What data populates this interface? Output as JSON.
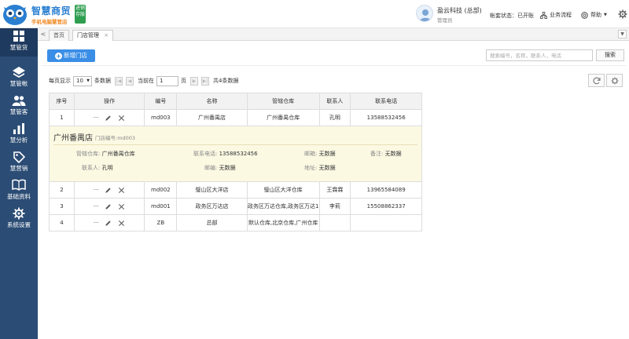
{
  "brand": {
    "title": "智慧商贸",
    "subtitle": "手机电脑慧管店",
    "badge": [
      "进销",
      "存版"
    ]
  },
  "header": {
    "company": "盈云科技 (总部)",
    "role": "管理员",
    "account_status": "帐套状态：已开账",
    "business_flow": "业务流程",
    "help": "帮助"
  },
  "sidebar": {
    "items": [
      {
        "label": "慧管货",
        "icon": "box-icon"
      },
      {
        "label": "慧管帐",
        "icon": "ledger-icon"
      },
      {
        "label": "慧管客",
        "icon": "users-icon"
      },
      {
        "label": "慧分析",
        "icon": "bar-chart-icon"
      },
      {
        "label": "慧营销",
        "icon": "tag-icon"
      },
      {
        "label": "基础资料",
        "icon": "book-icon"
      },
      {
        "label": "系统设置",
        "icon": "gear-icon"
      }
    ]
  },
  "tabs": {
    "back": "<",
    "items": [
      {
        "label": "首页"
      },
      {
        "label": "门店管理",
        "close": "×"
      }
    ]
  },
  "toolbar": {
    "new_label": "新增门店",
    "search_placeholder": "搜索编号，名称，联系人，电话",
    "search_label": "搜索"
  },
  "pager": {
    "per_page_label": "每页显示",
    "per_page_value": "10",
    "records_label": "条数据",
    "current_label": "当前在",
    "current_value": "1",
    "page_label": "页",
    "total_label": "共4条数据"
  },
  "table": {
    "headers": [
      "序号",
      "操作",
      "编号",
      "名称",
      "管辖仓库",
      "联系人",
      "联系电话"
    ],
    "rows": [
      {
        "index": "1",
        "code": "md003",
        "name": "广州番禺店",
        "warehouse": "广州番禺仓库",
        "contact": "孔明",
        "phone": "13588532456"
      },
      {
        "index": "2",
        "code": "md002",
        "name": "璧山区大洋店",
        "warehouse": "璧山区大洋仓库",
        "contact": "王霖霖",
        "phone": "13965584089"
      },
      {
        "index": "3",
        "code": "md001",
        "name": "政务区万达店",
        "warehouse": "政务区万达仓库,政务区万达1",
        "contact": "李莉",
        "phone": "15508862337"
      },
      {
        "index": "4",
        "code": "ZB",
        "name": "总部",
        "warehouse": "默认仓库,北京仓库,广州仓库",
        "contact": "",
        "phone": ""
      }
    ],
    "ops": {
      "more": "···"
    }
  },
  "detail": {
    "title": "广州番禺店",
    "code_text": "门店编号:md003",
    "warehouse_k": "管辖仓库:",
    "warehouse_v": "广州番禺仓库",
    "phone_k": "联系电话:",
    "phone_v": "13588532456",
    "email_k": "邮箱:",
    "email_v": "无数据",
    "remark_k": "备注:",
    "remark_v": "无数据",
    "contact_k": "联系人:",
    "contact_v": "孔明",
    "post_k": "邮编:",
    "post_v": "无数据",
    "addr_k": "地址:",
    "addr_v": "无数据"
  }
}
